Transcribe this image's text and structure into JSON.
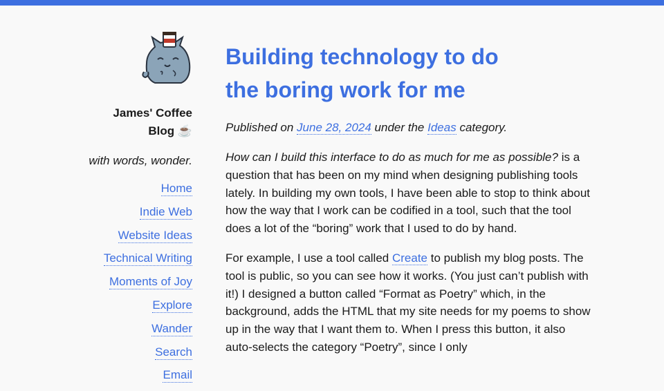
{
  "header": {
    "accent_color": "#3d6fe0"
  },
  "sidebar": {
    "avatar_icon": "cat-with-coffee-cup-icon",
    "site_title_line1": "James' Coffee",
    "site_title_line2": "Blog ☕",
    "tagline": "with words, wonder.",
    "nav": [
      {
        "label": "Home"
      },
      {
        "label": "Indie Web"
      },
      {
        "label": "Website Ideas"
      },
      {
        "label": "Technical Writing"
      },
      {
        "label": "Moments of Joy"
      },
      {
        "label": "Explore"
      },
      {
        "label": "Wander"
      },
      {
        "label": "Search"
      },
      {
        "label": "Email"
      }
    ]
  },
  "post": {
    "title": "Building technology to do the boring work for me",
    "meta_prefix": "Published on",
    "date": "June 28, 2024",
    "meta_middle": "under the",
    "category": "Ideas",
    "meta_suffix": "category.",
    "p1_italic": "How can I build this interface to do as much for me as possible?",
    "p1_rest": " is a question that has been on my mind when designing publishing tools lately. In building my own tools, I have been able to stop to think about how the way that I work can be codified in a tool, such that the tool does a lot of the “boring” work that I used to do by hand.",
    "p2_before": "For example, I use a tool called ",
    "p2_link": "Create",
    "p2_after": " to publish my blog posts. The tool is public, so you can see how it works. (You just can’t publish with it!) I designed a button called “Format as Poetry” which, in the background, adds the HTML that my site needs for my poems to show up in the way that I want them to. When I press this button, it also auto-selects the category “Poetry”, since I only"
  }
}
